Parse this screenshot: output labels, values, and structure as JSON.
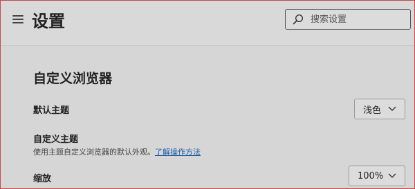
{
  "header": {
    "title": "设置",
    "search": {
      "placeholder": "搜索设置",
      "value": ""
    }
  },
  "section": {
    "title": "自定义浏览器"
  },
  "settings": {
    "theme": {
      "label": "默认主题",
      "value": "浅色"
    },
    "custom_theme": {
      "label": "自定义主题",
      "description": "使用主题自定义浏览器的默认外观。",
      "link": "了解操作方法"
    },
    "zoom": {
      "label": "缩放",
      "value": "100%"
    }
  },
  "icons": {
    "menu": "hamburger-menu-icon",
    "search": "search-icon",
    "dropdown": "chevron-down-icon"
  },
  "colors": {
    "link": "#1c5ca8",
    "background": "#d6d6d6",
    "border_accent": "#c54a4a"
  }
}
